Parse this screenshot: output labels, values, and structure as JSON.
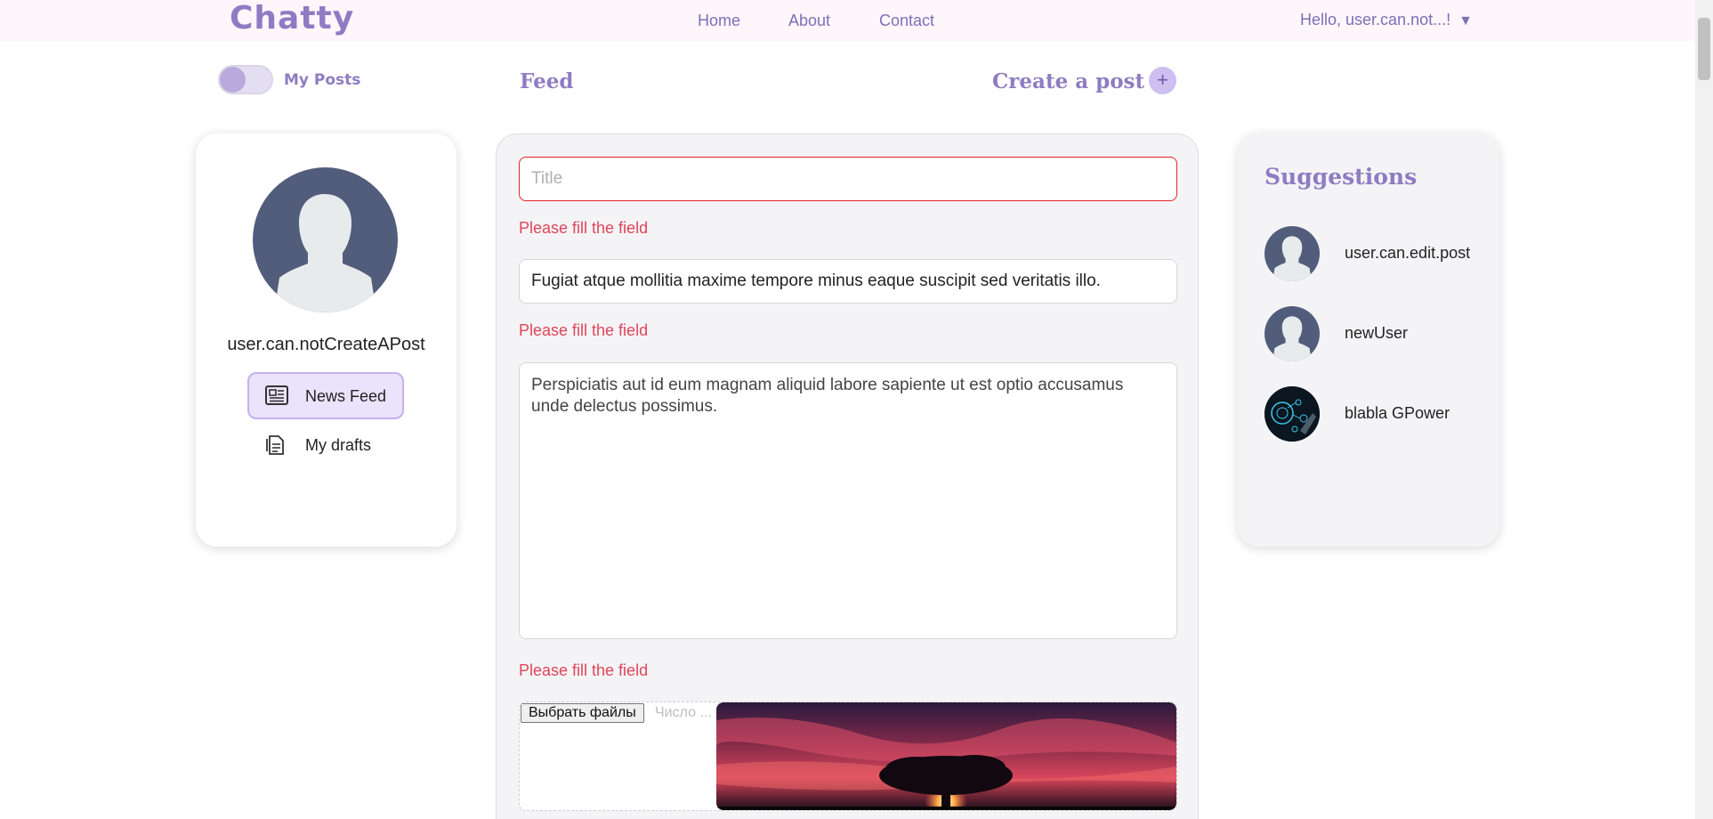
{
  "header": {
    "logo": "Chatty",
    "nav": [
      "Home",
      "About",
      "Contact"
    ],
    "greeting": "Hello, user.can.not...!",
    "greeting_arrow": "▼"
  },
  "toolbar": {
    "toggle_label": "My Posts",
    "toggle_on": false,
    "feed_title": "Feed",
    "create_post": "Create a post",
    "create_icon": "+"
  },
  "profile": {
    "username": "user.can.notCreateAPost",
    "menu": [
      {
        "label": "News Feed",
        "icon": "newspaper-icon",
        "active": true
      },
      {
        "label": "My drafts",
        "icon": "document-icon",
        "active": false
      }
    ]
  },
  "form": {
    "title_placeholder": "Title",
    "title_value": "",
    "description_value": "Fugiat atque mollitia maxime tempore minus eaque suscipit sed veritatis illo.",
    "body_value": "Perspiciatis aut id eum magnam aliquid labore sapiente ut est optio accusamus unde delectus possimus.",
    "error_text": "Please fill the field",
    "file_button": "Выбрать файлы",
    "file_count": "Число ..."
  },
  "suggestions": {
    "title": "Suggestions",
    "users": [
      {
        "name": "user.can.edit.post",
        "avatar": "default-avatar-icon"
      },
      {
        "name": "newUser",
        "avatar": "default-avatar-icon"
      },
      {
        "name": "blabla GPower",
        "avatar": "tech-avatar-image"
      }
    ]
  },
  "colors": {
    "accent": "#8e7cc3",
    "error": "#e0455a",
    "avatar_bg": "#525d7c",
    "header_bg": "#fdf6fb"
  }
}
